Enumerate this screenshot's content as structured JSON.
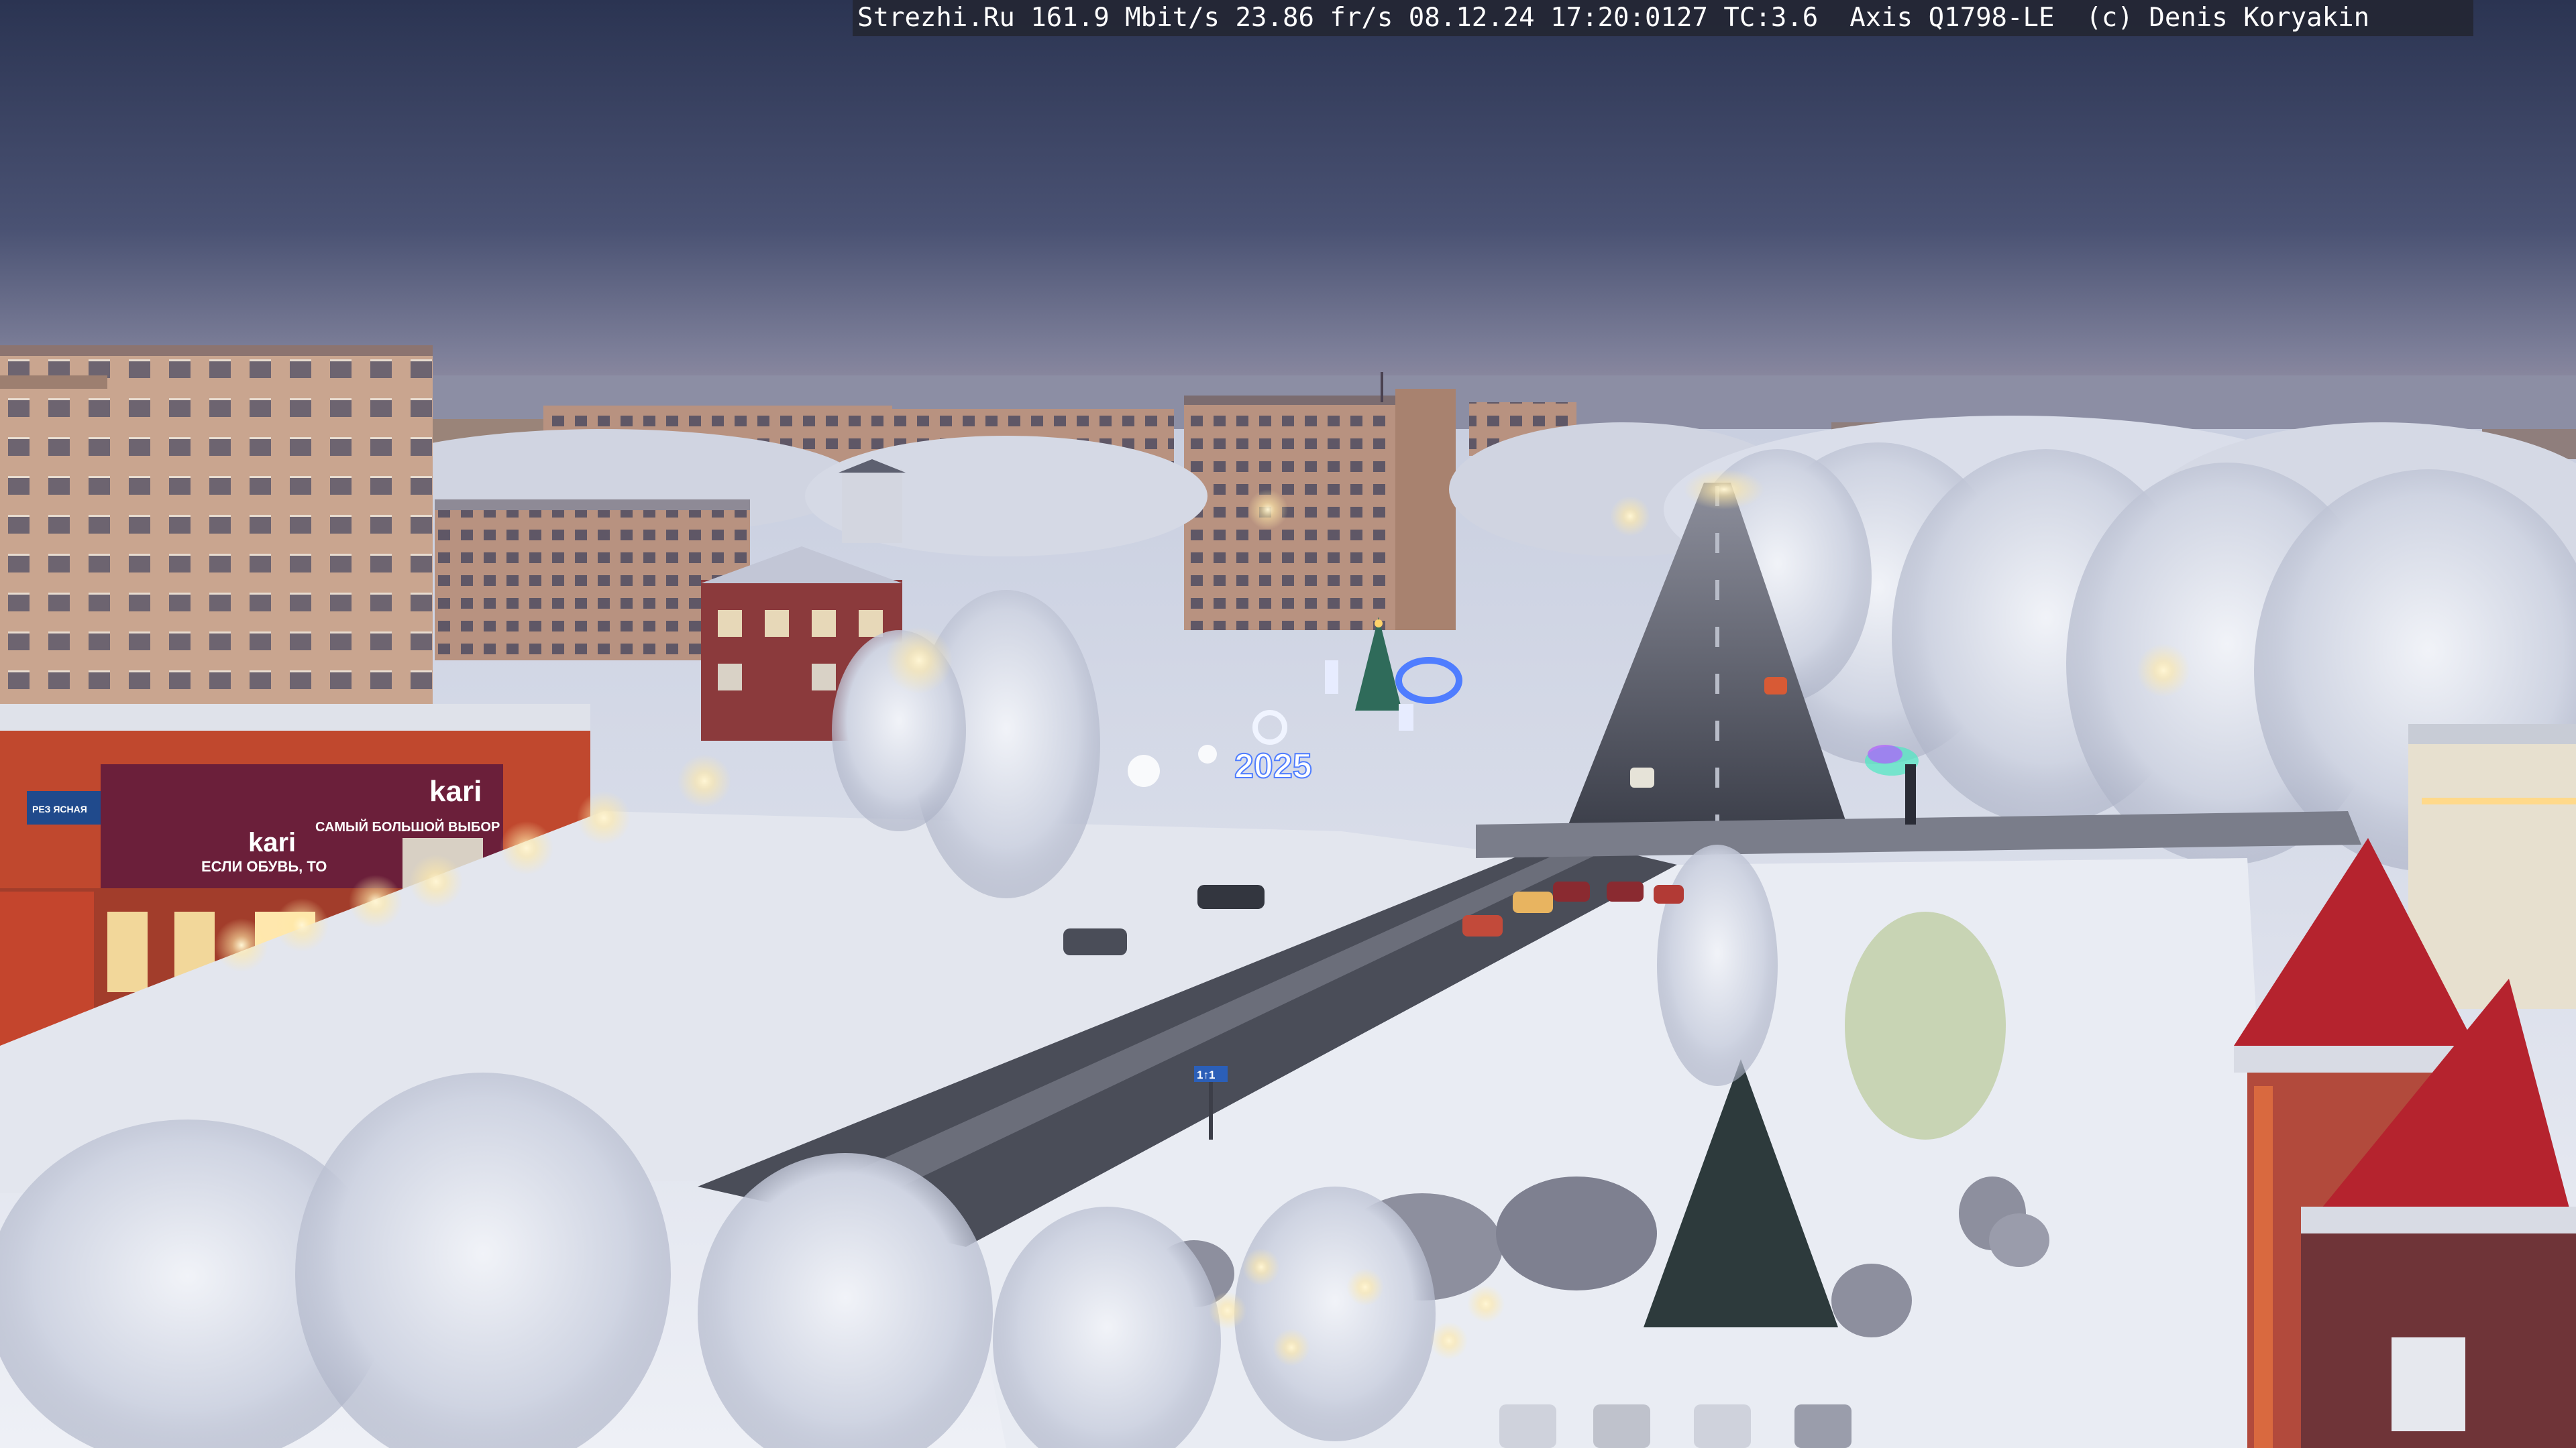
{
  "camera_overlay": {
    "text": "Strezhi.Ru 161.9 Mbit/s 23.86 fr/s 08.12.24 17:20:0127 TC:3.6  Axis Q1798-LE  (c) Denis Koryakin"
  },
  "signs": {
    "store_brand_left": "kari",
    "store_brand_right": "kari",
    "store_slogan_left": "ЕСЛИ ОБУВЬ, ТО",
    "store_slogan_right": "САМЫЙ БОЛЬШОЙ ВЫБОР",
    "store_small_sign": "РЕЗ ЯСНАЯ",
    "new_year_decoration": "2025",
    "road_sign_lanes": "1↑1"
  },
  "colors": {
    "sky_top": "#2c3550",
    "sky_horizon": "#8a8fa8",
    "snow": "#e4e7ef",
    "store_facade": "#c0482e",
    "store_band": "#6b1f3a",
    "street_light": "#fff3c8",
    "decoration_blue": "#4f7dff"
  }
}
